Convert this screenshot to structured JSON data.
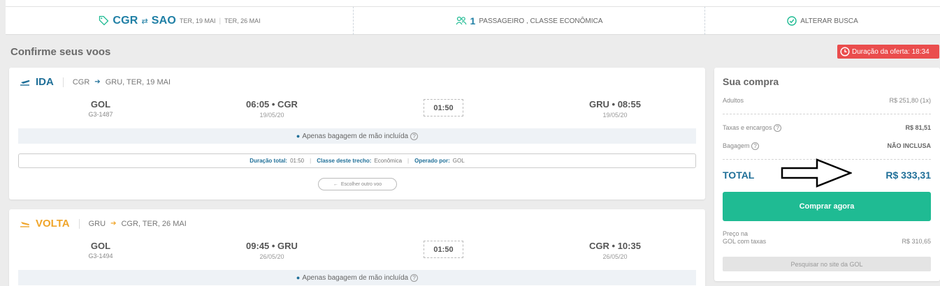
{
  "header": {
    "route_from": "CGR",
    "route_to": "SAO",
    "date_out": "TER, 19 MAI",
    "date_back": "TER, 26 MAI",
    "passengers_count": "1",
    "passengers_text": "PASSAGEIRO , CLASSE ECONÔMICA",
    "alter_search": "ALTERAR BUSCA"
  },
  "page": {
    "title": "Confirme seus voos",
    "offer_label": "Duração da oferta: 18:34"
  },
  "flights": [
    {
      "leg_title": "IDA",
      "route_from": "CGR",
      "route_to": "GRU, TER, 19 MAI",
      "airline": "GOL",
      "flight_no": "G3-1487",
      "dep_time": "06:05 • CGR",
      "dep_date": "19/05/20",
      "duration": "01:50",
      "arr_time": "GRU • 08:55",
      "arr_date": "19/05/20",
      "baggage": "Apenas bagagem de mão incluída",
      "details": {
        "total_label": "Duração total:",
        "total_value": "01:50",
        "class_label": "Classe deste trecho:",
        "class_value": "Econômica",
        "operated_label": "Operado por:",
        "operated_value": "GOL"
      },
      "choose_other": "Escolher outro voo"
    },
    {
      "leg_title": "VOLTA",
      "route_from": "GRU",
      "route_to": "CGR, TER, 26 MAI",
      "airline": "GOL",
      "flight_no": "G3-1494",
      "dep_time": "09:45 • GRU",
      "dep_date": "26/05/20",
      "duration": "01:50",
      "arr_time": "CGR • 10:35",
      "arr_date": "26/05/20",
      "baggage": "Apenas bagagem de mão incluída"
    }
  ],
  "summary": {
    "title": "Sua compra",
    "adults_label": "Adultos",
    "adults_value": "R$ 251,80 (1x)",
    "taxes_label": "Taxas e encargos",
    "taxes_value": "R$ 81,51",
    "baggage_label": "Bagagem",
    "baggage_value": "NÃO INCLUSA",
    "total_label": "TOTAL",
    "total_value": "R$ 333,31",
    "buy_label": "Comprar agora",
    "price_note_line1": "Preço na",
    "price_note_line2": "GOL com taxas",
    "price_note_value": "R$ 310,65",
    "search_gol_label": "Pesquisar no site da GOL"
  },
  "colors": {
    "brand_blue": "#1f6f98",
    "volta_orange": "#f0a52a",
    "buy_green": "#1fbb93",
    "offer_red": "#ea4d4d"
  }
}
